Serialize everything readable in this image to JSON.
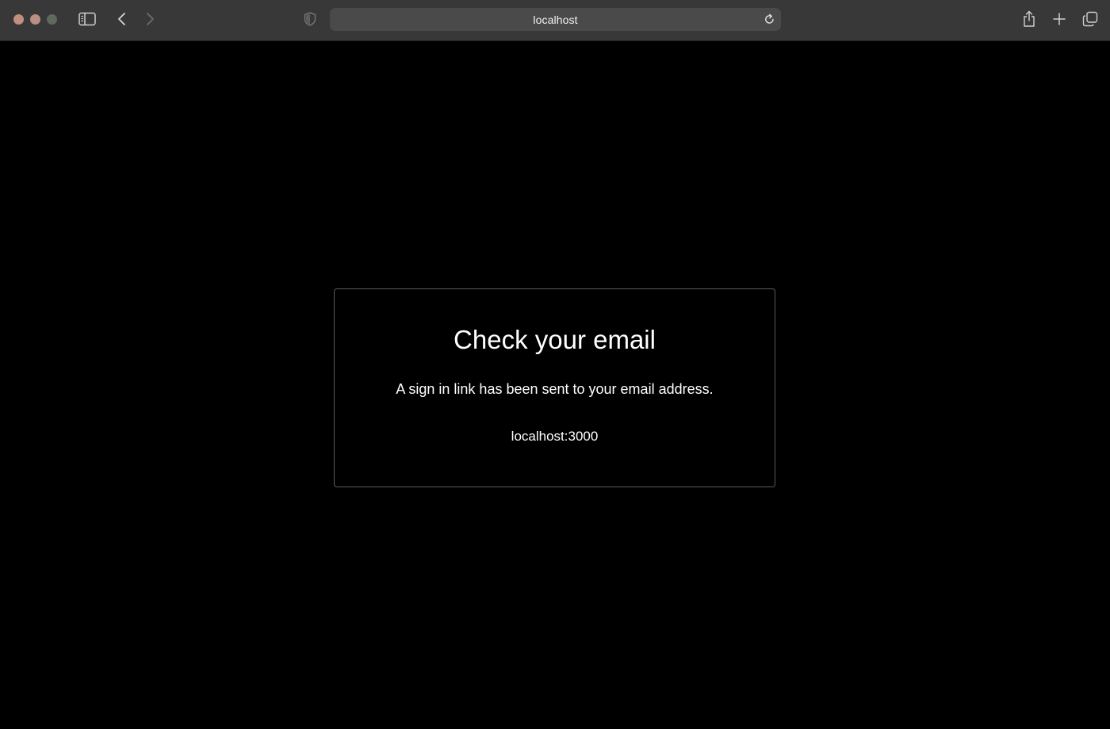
{
  "browser": {
    "address": "localhost",
    "icons": {
      "sidebar": "sidebar-icon",
      "back": "chevron-left-icon",
      "forward": "chevron-right-icon",
      "privacy": "shield-icon",
      "reload": "reload-icon",
      "share": "share-icon",
      "new_tab": "plus-icon",
      "tab_overview": "tabs-icon"
    },
    "colors": {
      "toolbar": "#383838",
      "address_bar": "#4a4a4a",
      "close": "#c08f7e",
      "minimize": "#b98f84",
      "zoom": "#5e6a5c"
    }
  },
  "page": {
    "background": "#000000",
    "card": {
      "title": "Check your email",
      "message": "A sign in link has been sent to your email address.",
      "link": "localhost:3000",
      "border_color": "#5a5a5a"
    }
  }
}
